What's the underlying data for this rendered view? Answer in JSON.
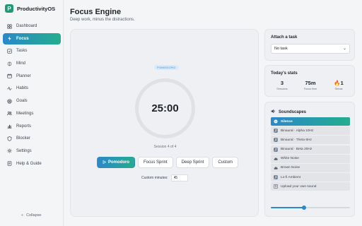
{
  "app": {
    "name": "ProductivityOS",
    "logo_letter": "P"
  },
  "sidebar": {
    "items": [
      {
        "label": "Dashboard",
        "icon": "dashboard-icon",
        "active": false
      },
      {
        "label": "Focus",
        "icon": "lightning-icon",
        "active": true
      },
      {
        "label": "Tasks",
        "icon": "checkbox-icon",
        "active": false
      },
      {
        "label": "Mind",
        "icon": "brain-icon",
        "active": false
      },
      {
        "label": "Planner",
        "icon": "calendar-icon",
        "active": false
      },
      {
        "label": "Habits",
        "icon": "pulse-icon",
        "active": false
      },
      {
        "label": "Goals",
        "icon": "target-icon",
        "active": false
      },
      {
        "label": "Meetings",
        "icon": "people-icon",
        "active": false
      },
      {
        "label": "Reports",
        "icon": "chart-icon",
        "active": false
      },
      {
        "label": "Blocker",
        "icon": "block-icon",
        "active": false
      },
      {
        "label": "Settings",
        "icon": "gear-icon",
        "active": false
      },
      {
        "label": "Help & Guide",
        "icon": "help-icon",
        "active": false
      }
    ],
    "collapse_label": "Collapse"
  },
  "header": {
    "title": "Focus Engine",
    "subtitle": "Deep work, minus the distractions."
  },
  "timer": {
    "mode_badge": "POMODORO",
    "time": "25:00",
    "session": "Session 4 of 4",
    "modes": [
      {
        "label": "Pomodoro",
        "active": true
      },
      {
        "label": "Focus Sprint",
        "active": false
      },
      {
        "label": "Deep Sprint",
        "active": false
      },
      {
        "label": "Custom",
        "active": false
      }
    ],
    "custom_label": "Custom minutes:",
    "custom_value": "45"
  },
  "attach": {
    "title": "Attach a task",
    "selected": "No task"
  },
  "stats": {
    "title": "Today's stats",
    "items": [
      {
        "value": "3",
        "label": "Sessions"
      },
      {
        "value": "75m",
        "label": "Focus time"
      },
      {
        "value": "🔥1",
        "label": "Streak"
      }
    ]
  },
  "soundscapes": {
    "title": "Soundscapes",
    "items": [
      {
        "label": "Silence",
        "icon": "mute-icon",
        "active": true
      },
      {
        "label": "Binaural · Alpha 10Hz",
        "icon": "music-note-icon",
        "active": false
      },
      {
        "label": "Binaural · Theta 6Hz",
        "icon": "music-note-icon",
        "active": false
      },
      {
        "label": "Binaural · Beta 20Hz",
        "icon": "music-note-icon",
        "active": false
      },
      {
        "label": "White Noise",
        "icon": "cloud-icon",
        "active": false
      },
      {
        "label": "Brown Noise",
        "icon": "cloud-icon",
        "active": false
      },
      {
        "label": "Lo-fi Ambient",
        "icon": "music-note-icon",
        "active": false
      },
      {
        "label": "Upload your own sound",
        "icon": "upload-icon",
        "active": false
      }
    ],
    "volume_fraction": 0.42
  },
  "colors": {
    "accent_start": "#2b88c9",
    "accent_end": "#23ad8e",
    "brand": "#1f9a72"
  }
}
